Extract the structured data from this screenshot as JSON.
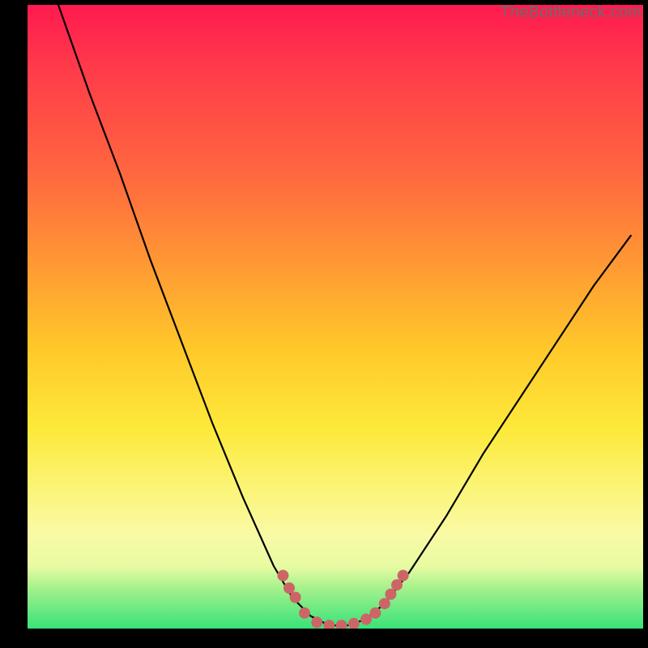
{
  "watermark": "TheBottleneck.com",
  "chart_data": {
    "type": "line",
    "title": "",
    "xlabel": "",
    "ylabel": "",
    "x_range": [
      0,
      100
    ],
    "y_range": [
      0,
      100
    ],
    "series": [
      {
        "name": "bottleneck-curve",
        "color": "#000000",
        "x": [
          5,
          10,
          15,
          20,
          25,
          30,
          35,
          40,
          43,
          46,
          49,
          52,
          55,
          58,
          62,
          68,
          74,
          80,
          86,
          92,
          98
        ],
        "y": [
          100,
          86,
          73,
          59,
          46,
          33,
          21,
          10,
          5,
          2,
          0.5,
          0.5,
          1.5,
          4,
          9,
          18,
          28,
          37,
          46,
          55,
          63
        ]
      }
    ],
    "markers": {
      "name": "highlight-dots",
      "color": "#cc6666",
      "points": [
        {
          "x": 41.5,
          "y": 8.5
        },
        {
          "x": 42.5,
          "y": 6.5
        },
        {
          "x": 43.5,
          "y": 5.0
        },
        {
          "x": 45.0,
          "y": 2.5
        },
        {
          "x": 47.0,
          "y": 1.0
        },
        {
          "x": 49.0,
          "y": 0.5
        },
        {
          "x": 51.0,
          "y": 0.5
        },
        {
          "x": 53.0,
          "y": 0.8
        },
        {
          "x": 55.0,
          "y": 1.5
        },
        {
          "x": 56.5,
          "y": 2.5
        },
        {
          "x": 58.0,
          "y": 4.0
        },
        {
          "x": 59.0,
          "y": 5.5
        },
        {
          "x": 60.0,
          "y": 7.0
        },
        {
          "x": 61.0,
          "y": 8.5
        }
      ]
    },
    "gradient_stops": [
      {
        "pos": 0.0,
        "color": "#ff1a4f"
      },
      {
        "pos": 0.1,
        "color": "#ff3a4a"
      },
      {
        "pos": 0.28,
        "color": "#ff6a3f"
      },
      {
        "pos": 0.42,
        "color": "#ff9a33"
      },
      {
        "pos": 0.55,
        "color": "#ffc82a"
      },
      {
        "pos": 0.68,
        "color": "#fde93a"
      },
      {
        "pos": 0.78,
        "color": "#fbf57a"
      },
      {
        "pos": 0.85,
        "color": "#f9faa6"
      },
      {
        "pos": 0.9,
        "color": "#e8fba2"
      },
      {
        "pos": 0.94,
        "color": "#9cf08a"
      },
      {
        "pos": 1.0,
        "color": "#39e27a"
      }
    ]
  }
}
